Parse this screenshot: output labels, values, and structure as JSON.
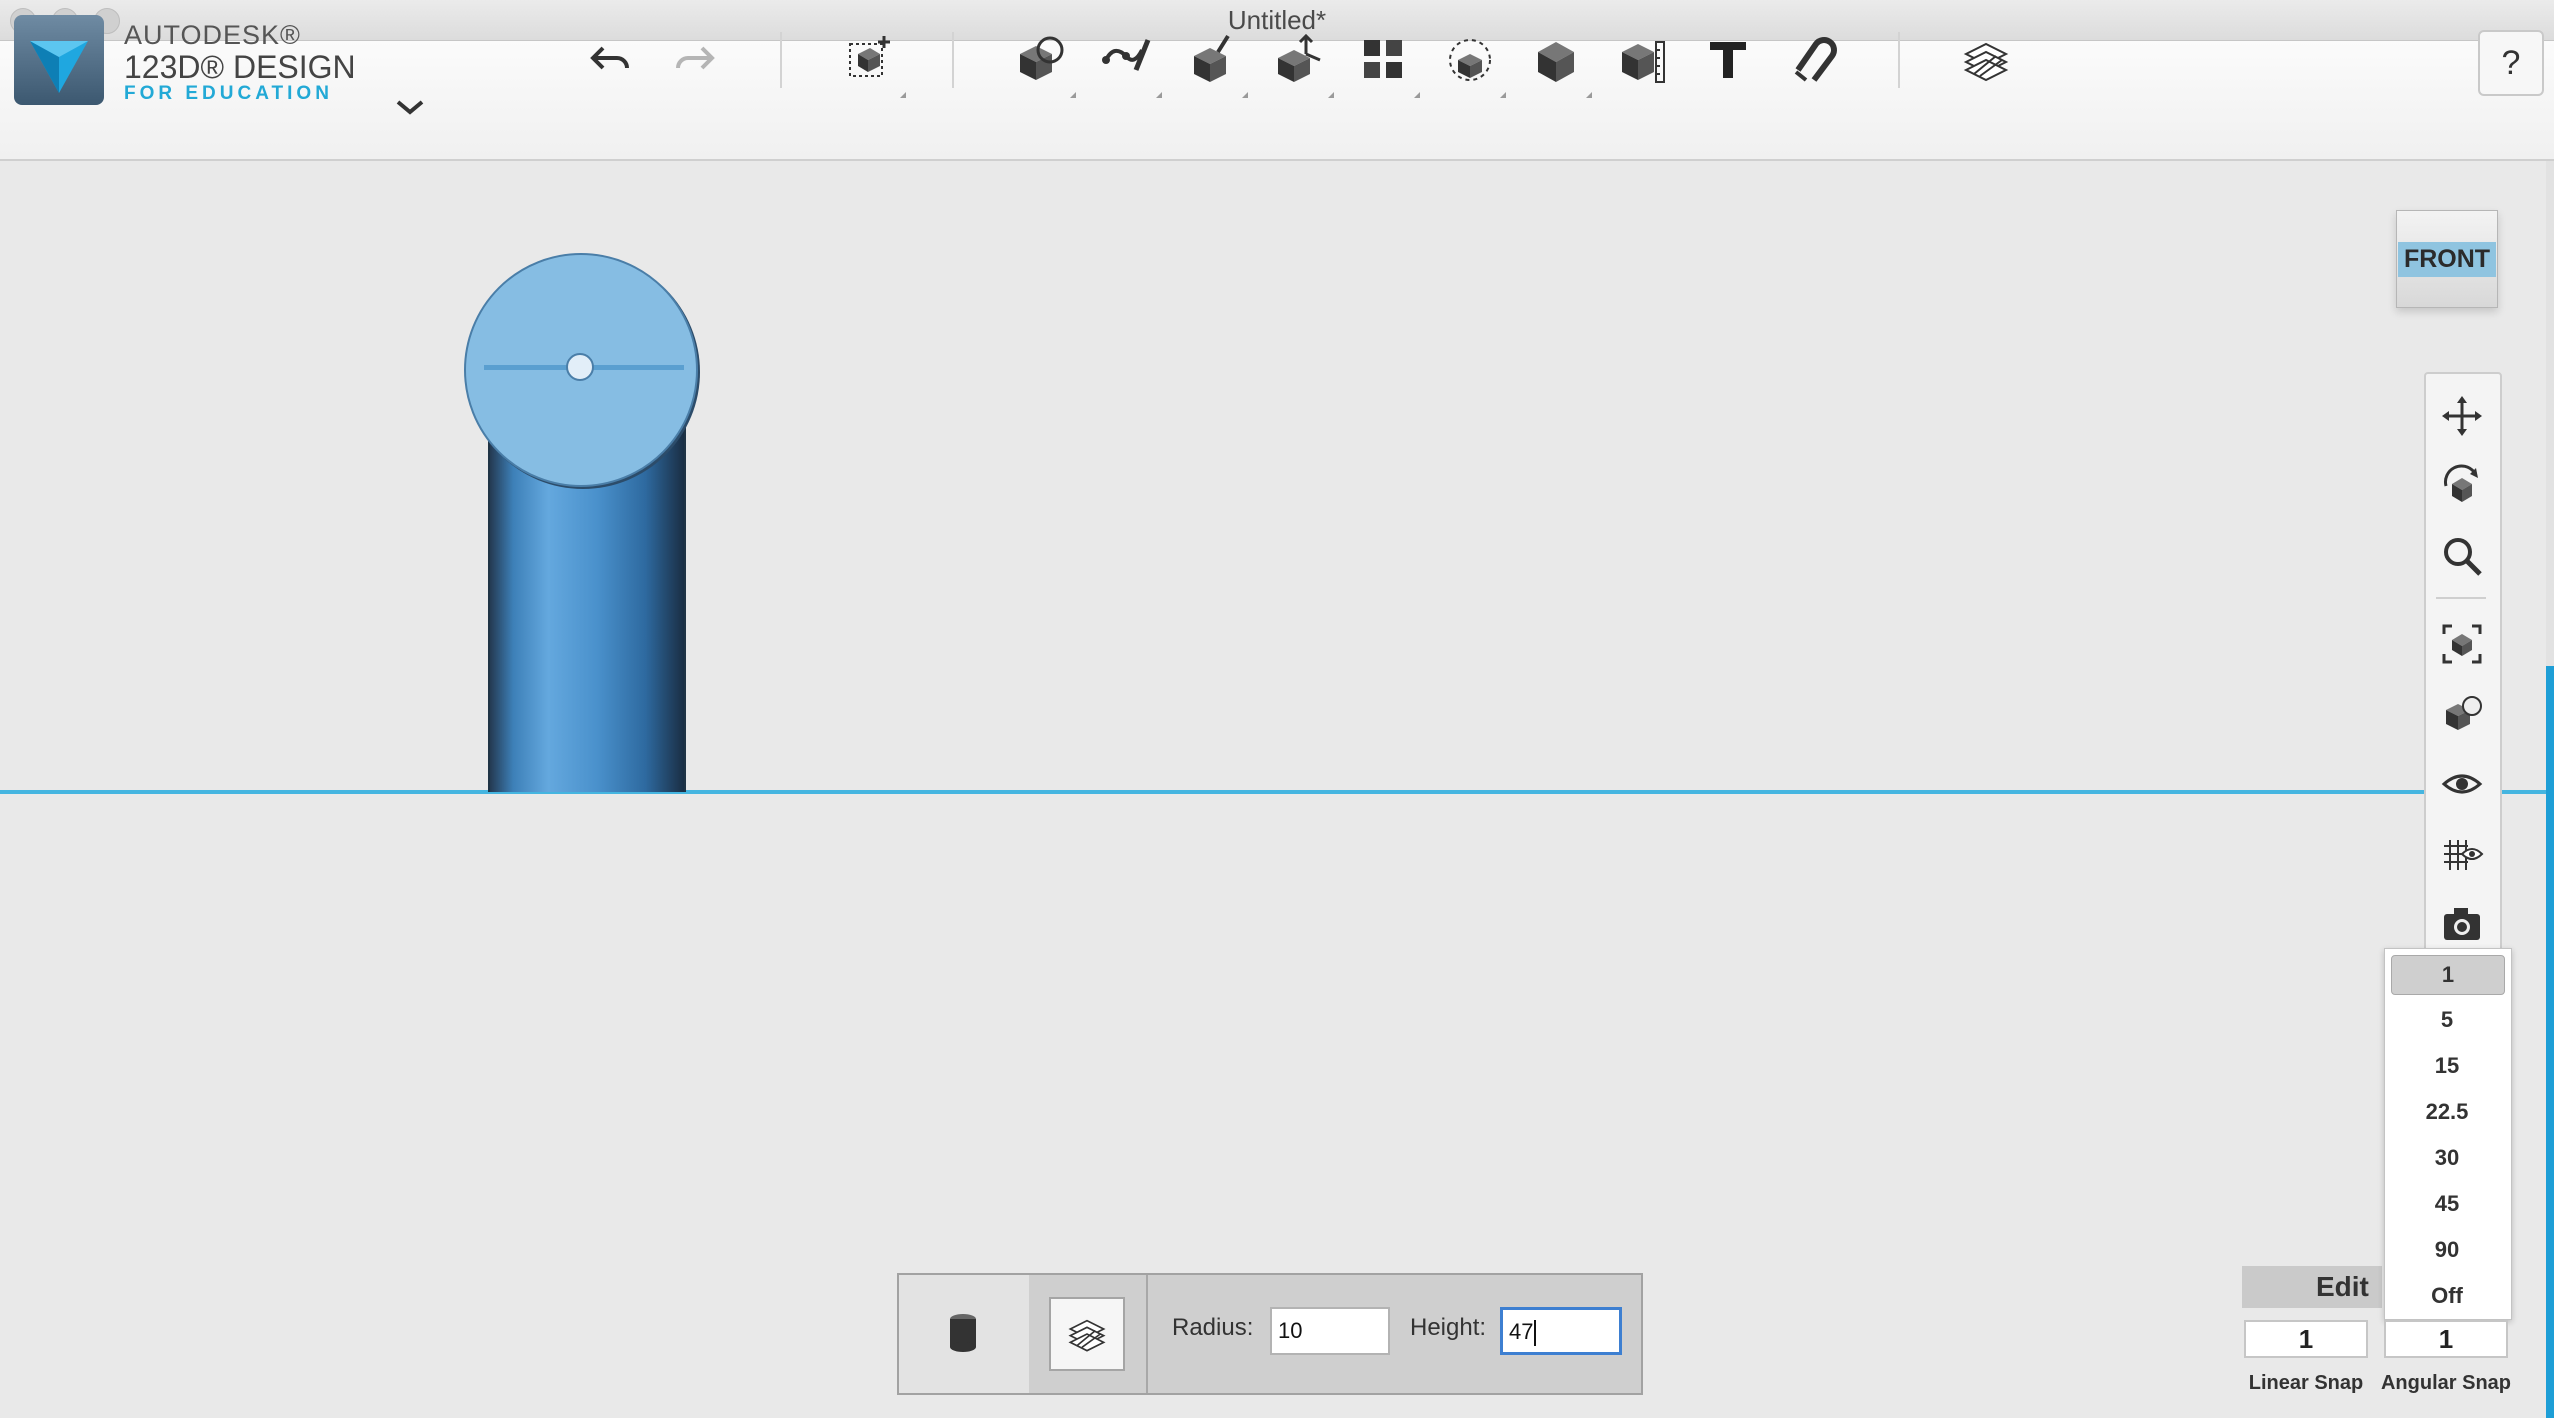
{
  "window": {
    "title": "Untitled*"
  },
  "brand": {
    "line1": "AUTODESK®",
    "line2": "123D® DESIGN",
    "line3": "FOR EDUCATION"
  },
  "toolbar": {
    "tools": [
      "undo-icon",
      "redo-icon",
      "transform-icon",
      "primitives-icon",
      "sketch-icon",
      "construct-icon",
      "modify-icon",
      "pattern-icon",
      "grouping-icon",
      "combine-icon",
      "measure-icon",
      "text-icon",
      "snap-icon",
      "material-icon"
    ],
    "help_label": "?"
  },
  "viewcube": {
    "label": "FRONT"
  },
  "navigation": {
    "tools": [
      "pan-icon",
      "orbit-icon",
      "zoom-icon",
      "fit-icon",
      "view-mode-icon",
      "visibility-icon",
      "grid-icon",
      "camera-icon"
    ]
  },
  "angular_snap_dropdown": {
    "options": [
      "1",
      "5",
      "15",
      "22.5",
      "30",
      "45",
      "90",
      "Off"
    ],
    "selected": "1"
  },
  "edit_grid": {
    "label": "Edit"
  },
  "snap": {
    "linear_value": "1",
    "linear_label": "Linear Snap",
    "angular_value": "1",
    "angular_label": "Angular Snap"
  },
  "primitive_panel": {
    "radius_label": "Radius:",
    "radius_value": "10",
    "height_label": "Height:",
    "height_value": "47"
  },
  "colors": {
    "accent": "#1e9ed6",
    "cylinder": "#4a91cc",
    "ground_line": "#45b5e0"
  }
}
